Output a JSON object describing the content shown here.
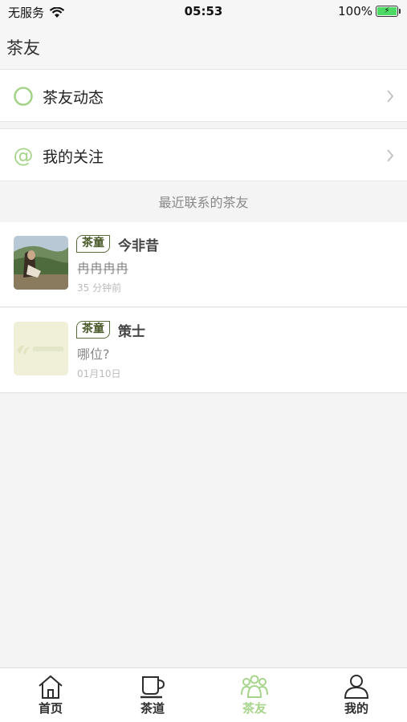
{
  "status": {
    "carrier": "无服务",
    "time": "05:53",
    "battery": "100%"
  },
  "nav": {
    "title": "茶友"
  },
  "menu": [
    {
      "label": "茶友动态",
      "icon": "circle-ring-icon"
    },
    {
      "label": "我的关注",
      "icon": "at-sign-icon"
    }
  ],
  "section_title": "最近联系的茶友",
  "contacts": [
    {
      "tag": "茶童",
      "name": "今非昔",
      "message": "冉冉冉冉",
      "time": "35 分钟前"
    },
    {
      "tag": "茶童",
      "name": "策士",
      "message": "哪位?",
      "time": "01月10日"
    }
  ],
  "tabs": [
    {
      "label": "首页",
      "icon": "house-icon"
    },
    {
      "label": "茶道",
      "icon": "tea-cup-icon"
    },
    {
      "label": "茶友",
      "icon": "friends-icon",
      "active": true
    },
    {
      "label": "我的",
      "icon": "user-icon"
    }
  ],
  "colors": {
    "accent": "#a6d48a",
    "tag_border": "#5a6b3a",
    "background": "#f4f4f4"
  }
}
